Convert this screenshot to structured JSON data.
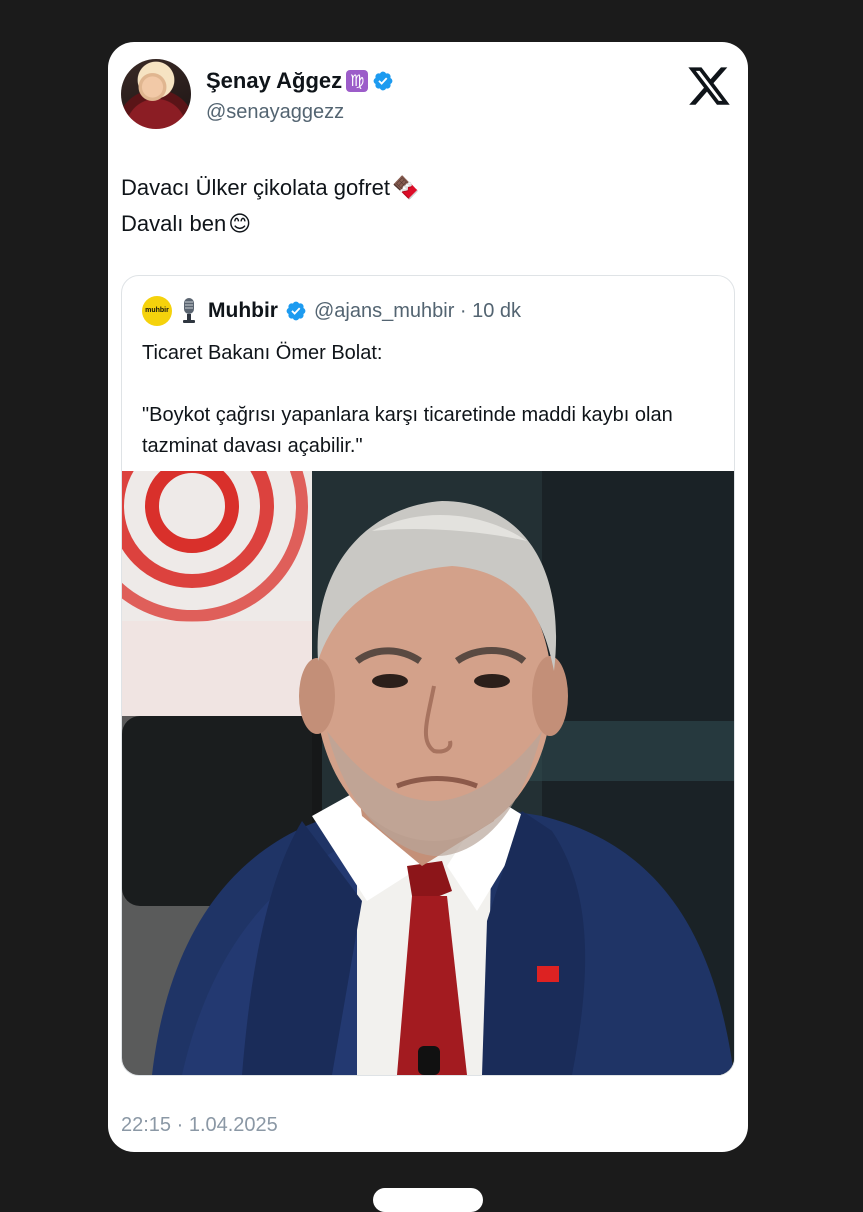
{
  "tweet": {
    "display_name": "Şenay Ağgez",
    "zodiac_symbol": "♍",
    "handle": "@senayaggezz",
    "text_lines": [
      "Davacı Ülker çikolata gofret",
      "Davalı ben"
    ],
    "line1_emoji": "🍫",
    "line2_emoji": "😊",
    "timestamp": "22:15 · 1.04.2025"
  },
  "quoted": {
    "logo_text": "muhbir",
    "name": "Muhbir",
    "handle_time": "@ajans_muhbir · 10 dk",
    "paragraphs": [
      "Ticaret Bakanı Ömer Bolat:",
      "\"Boykot çağrısı yapanlara karşı ticaretinde maddi kaybı olan tazminat davası açabilir.\""
    ]
  },
  "icons": {
    "platform": "x-logo-icon",
    "verified": "verified-badge-icon",
    "mic": "microphone-icon"
  },
  "colors": {
    "background": "#1b1b1b",
    "card": "#ffffff",
    "verified": "#1d9bf0",
    "muhbir_logo": "#f5d20c",
    "zodiac_badge": "#9c5cc9"
  }
}
